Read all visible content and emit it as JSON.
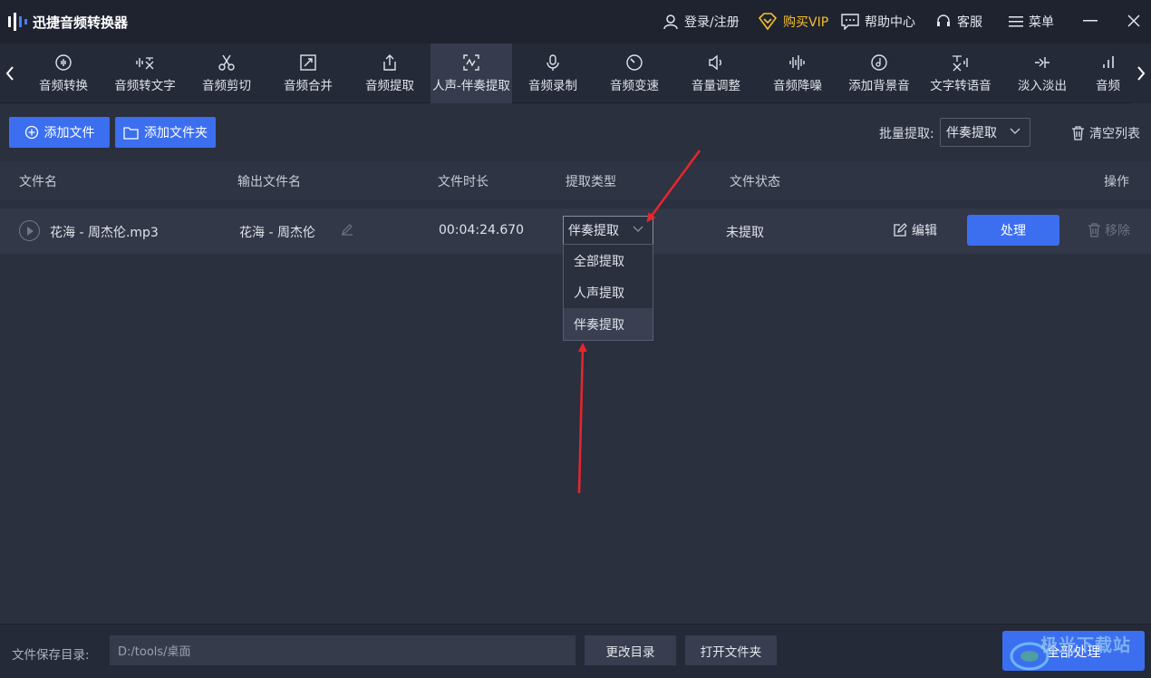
{
  "app": {
    "title": "迅捷音频转换器"
  },
  "titlebar": {
    "login": "登录/注册",
    "vip": "购买VIP",
    "help": "帮助中心",
    "service": "客服",
    "menu": "菜单"
  },
  "features": [
    {
      "label": "音频转换",
      "icon": "audio-convert-icon"
    },
    {
      "label": "音频转文字",
      "icon": "audio-to-text-icon"
    },
    {
      "label": "音频剪切",
      "icon": "scissors-icon"
    },
    {
      "label": "音频合并",
      "icon": "merge-icon"
    },
    {
      "label": "音频提取",
      "icon": "upload-icon"
    },
    {
      "label": "人声-伴奏提取",
      "icon": "vocal-extract-icon",
      "active": true
    },
    {
      "label": "音频录制",
      "icon": "microphone-icon"
    },
    {
      "label": "音频变速",
      "icon": "speed-icon"
    },
    {
      "label": "音量调整",
      "icon": "volume-icon"
    },
    {
      "label": "音频降噪",
      "icon": "denoise-icon"
    },
    {
      "label": "添加背景音",
      "icon": "music-note-icon"
    },
    {
      "label": "文字转语音",
      "icon": "text-to-speech-icon"
    },
    {
      "label": "淡入淡出",
      "icon": "fade-icon"
    },
    {
      "label": "音频",
      "icon": "bars-icon"
    }
  ],
  "actions": {
    "add_file": "添加文件",
    "add_folder": "添加文件夹",
    "batch_label": "批量提取:",
    "batch_value": "伴奏提取",
    "clear_list": "清空列表"
  },
  "table": {
    "headers": [
      "文件名",
      "输出文件名",
      "文件时长",
      "提取类型",
      "文件状态",
      "操作"
    ],
    "rows": [
      {
        "file_name": "花海 - 周杰伦.mp3",
        "output_name": "花海 - 周杰伦",
        "duration": "00:04:24.670",
        "extract_type": "伴奏提取",
        "status": "未提取",
        "edit": "编辑",
        "process": "处理",
        "remove": "移除"
      }
    ]
  },
  "dropdown": {
    "options": [
      "全部提取",
      "人声提取",
      "伴奏提取"
    ],
    "highlighted": "伴奏提取"
  },
  "footer": {
    "save_label": "文件保存目录:",
    "path": "D:/tools/桌面",
    "change_dir": "更改目录",
    "open_folder": "打开文件夹",
    "process_all": "全部处理"
  },
  "watermark": {
    "text": "极光下载站"
  },
  "colors": {
    "accent": "#3c6ff0",
    "vip": "#f5c12b",
    "annotation": "#e8262c"
  }
}
